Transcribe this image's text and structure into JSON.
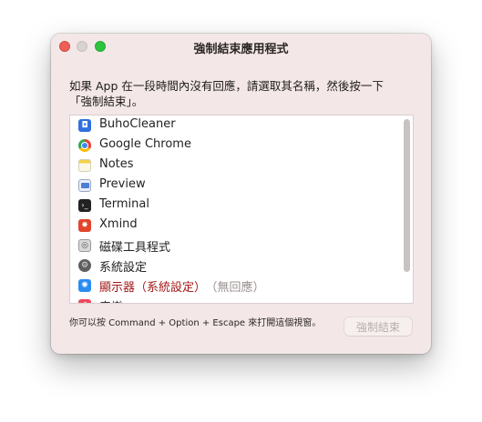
{
  "window": {
    "title": "強制結束應用程式"
  },
  "message": {
    "line1": "如果 App 在一段時間內沒有回應，請選取其名稱，然後按一下",
    "line2": "「強制結束」。"
  },
  "apps": [
    {
      "name": "BuhoCleaner",
      "icon": "buhocleaner-icon",
      "color": "#2f6fe0",
      "glyph": "◘"
    },
    {
      "name": "Google Chrome",
      "icon": "chrome-icon",
      "color": "#e3a21a",
      "glyph": "●"
    },
    {
      "name": "Notes",
      "icon": "notes-icon",
      "color": "#f5d24b",
      "glyph": "≡"
    },
    {
      "name": "Preview",
      "icon": "preview-icon",
      "color": "#4a7fd4",
      "glyph": "▭"
    },
    {
      "name": "Terminal",
      "icon": "terminal-icon",
      "color": "#222222",
      "glyph": "›"
    },
    {
      "name": "Xmind",
      "icon": "xmind-icon",
      "color": "#e2452c",
      "glyph": "✸"
    },
    {
      "name": "磁碟工具程式",
      "icon": "disk-utility-icon",
      "color": "#8a8a8a",
      "glyph": "◎"
    },
    {
      "name": "系統設定",
      "icon": "system-settings-icon",
      "color": "#6b6b6b",
      "glyph": "⚙"
    },
    {
      "name": "顯示器（系統設定）",
      "status": "（無回應）",
      "icon": "display-icon",
      "color": "#2a8cf0",
      "glyph": "✺"
    },
    {
      "name": "音樂",
      "icon": "music-icon",
      "color": "#f0475e",
      "glyph": "♪"
    }
  ],
  "footer": {
    "hint": "你可以按 Command + Option + Escape 來打開這個視窗。",
    "force_quit_label": "強制結束"
  }
}
